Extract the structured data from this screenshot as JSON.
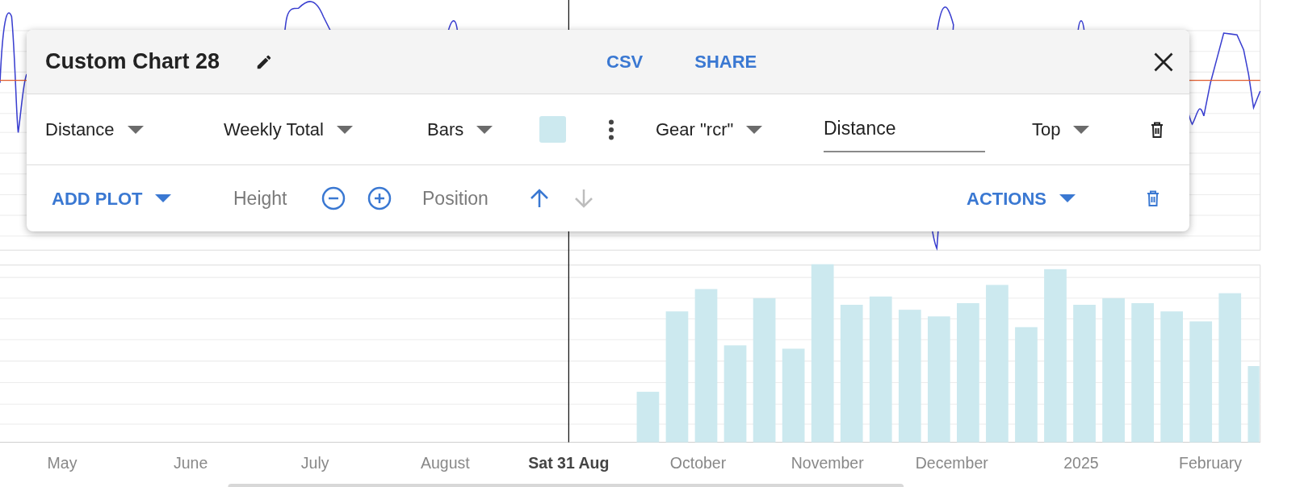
{
  "chart": {
    "x_axis_labels": [
      {
        "label": "May",
        "current": false
      },
      {
        "label": "June",
        "current": false
      },
      {
        "label": "July",
        "current": false
      },
      {
        "label": "August",
        "current": false
      },
      {
        "label": "Sat 31 Aug",
        "current": true
      },
      {
        "label": "October",
        "current": false
      },
      {
        "label": "November",
        "current": false
      },
      {
        "label": "December",
        "current": false
      },
      {
        "label": "2025",
        "current": false
      },
      {
        "label": "February",
        "current": false
      }
    ]
  },
  "dialog": {
    "title": "Custom Chart 28",
    "header_actions": [
      "CSV",
      "SHARE"
    ],
    "plot": {
      "metric": "Distance",
      "aggregation": "Weekly Total",
      "style": "Bars",
      "color": "#cce9ef",
      "filter": "Gear \"rcr\"",
      "label_value": "Distance",
      "axis": "Top"
    },
    "toolbar": {
      "add_plot": "ADD PLOT",
      "height_label": "Height",
      "position_label": "Position",
      "move_up_disabled": false,
      "move_down_disabled": true,
      "actions": "ACTIONS"
    }
  }
}
